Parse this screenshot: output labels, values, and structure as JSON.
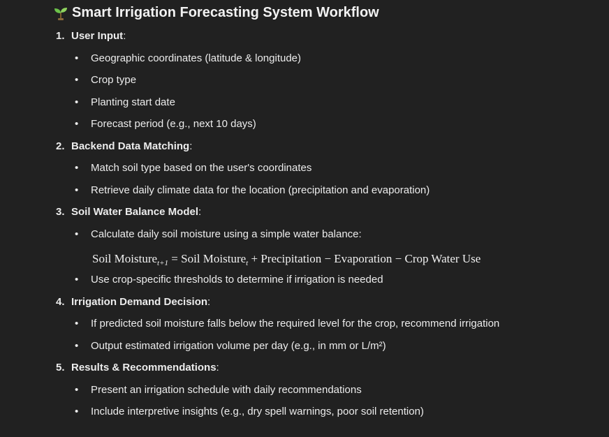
{
  "title": {
    "text": "Smart Irrigation Forecasting System Workflow",
    "icon": "seedling-icon"
  },
  "sections": [
    {
      "number": "1.",
      "heading": "User Input",
      "suffix": ":",
      "bullets": [
        "Geographic coordinates (latitude & longitude)",
        "Crop type",
        "Planting start date",
        "Forecast period (e.g., next 10 days)"
      ]
    },
    {
      "number": "2.",
      "heading": "Backend Data Matching",
      "suffix": ":",
      "bullets": [
        "Match soil type based on the user's coordinates",
        "Retrieve daily climate data for the location (precipitation and evaporation)"
      ]
    },
    {
      "number": "3.",
      "heading": "Soil Water Balance Model",
      "suffix": ":",
      "bullets": [
        "Calculate daily soil moisture using a simple water balance:",
        "Use crop-specific thresholds to determine if irrigation is needed"
      ],
      "formula": {
        "lhs": "Soil Moisture",
        "lhs_sub": "t+1",
        "eq": " = ",
        "rhs1": "Soil Moisture",
        "rhs1_sub": "t",
        "plus": " + ",
        "term2": "Precipitation",
        "minus1": " − ",
        "term3": "Evaporation",
        "minus2": " − ",
        "term4": "Crop Water Use"
      }
    },
    {
      "number": "4.",
      "heading": "Irrigation Demand Decision",
      "suffix": ":",
      "bullets": [
        "If predicted soil moisture falls below the required level for the crop, recommend irrigation",
        "Output estimated irrigation volume per day (e.g., in mm or L/m²)"
      ]
    },
    {
      "number": "5.",
      "heading": "Results & Recommendations",
      "suffix": ":",
      "bullets": [
        "Present an irrigation schedule with daily recommendations",
        "Include interpretive insights (e.g., dry spell warnings, poor soil retention)"
      ]
    }
  ],
  "bullet_glyph": "•"
}
